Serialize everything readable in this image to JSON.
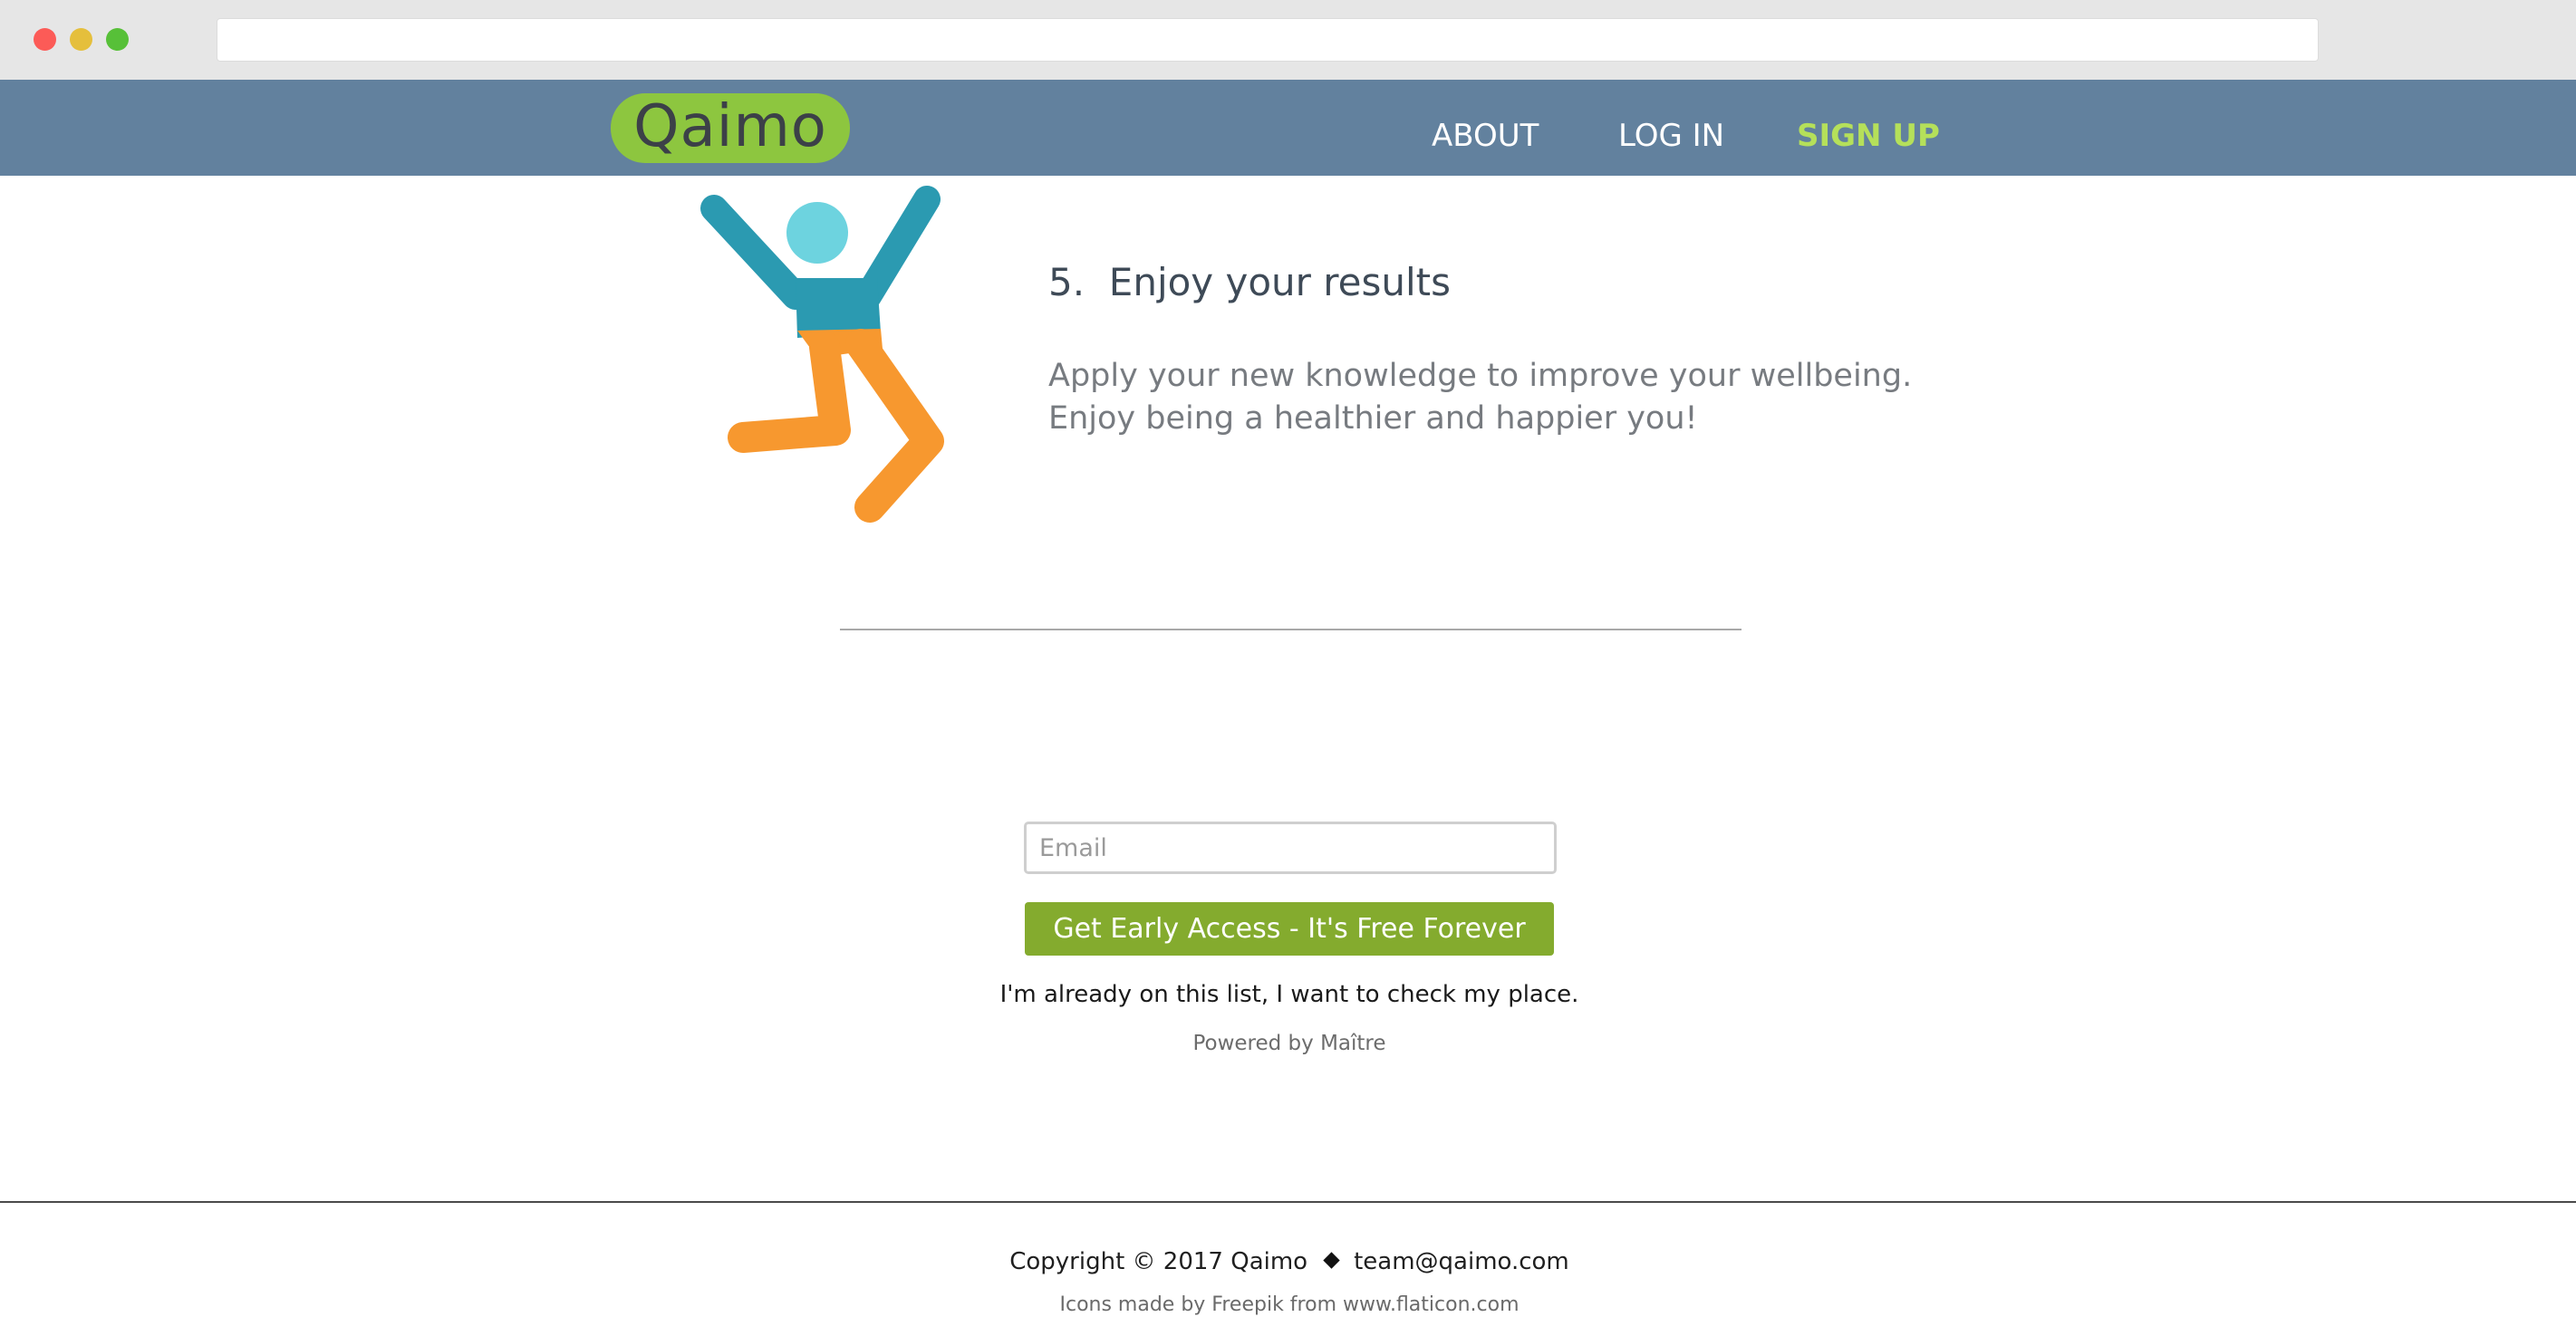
{
  "header": {
    "logo_text": "Qaimo",
    "nav": {
      "about": "ABOUT",
      "login": "LOG IN",
      "signup": "SIGN UP"
    }
  },
  "step": {
    "number": "5.",
    "title": "Enjoy your results",
    "description_line1": "Apply your new knowledge to improve your wellbeing.",
    "description_line2": "Enjoy being a healthier and happier you!",
    "illustration_icon": "jumping-person-icon"
  },
  "signup": {
    "email_placeholder": "Email",
    "email_value": "",
    "button_label": "Get Early Access - It's Free Forever",
    "check_place_link": "I'm already on this list, I want to check my place.",
    "powered_by": "Powered by Maître"
  },
  "footer": {
    "copyright": "Copyright © 2017 Qaimo",
    "separator_icon": "diamond-icon",
    "email": "team@qaimo.com",
    "credits": "Icons made by Freepik from www.flaticon.com"
  },
  "colors": {
    "header_bg": "#62819e",
    "logo_bg": "#8dc63f",
    "signup_accent": "#b5e05a",
    "button_bg": "#84ab2e",
    "figure_blue": "#2b9ab1",
    "figure_head": "#6dd3df",
    "figure_orange": "#f7982f"
  }
}
